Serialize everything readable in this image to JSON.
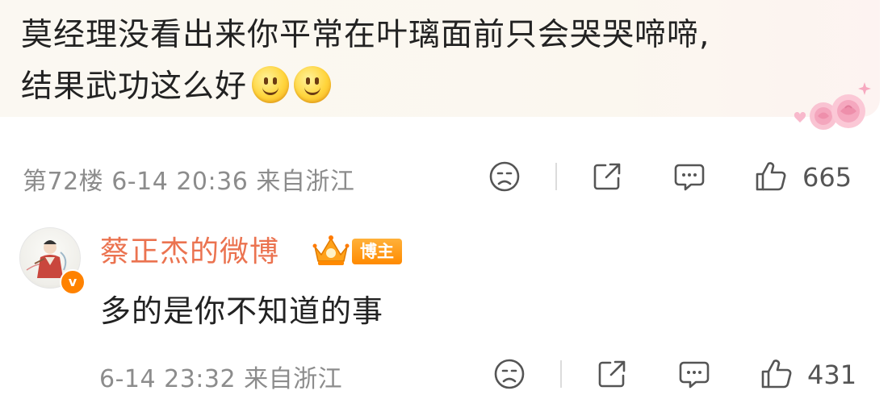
{
  "comment": {
    "text_line1": "莫经理没看出来你平常在叶璃面前只会哭哭啼啼,",
    "text_line2": "结果武功这么好",
    "emojis": [
      "smile-emoji",
      "smile-emoji"
    ],
    "meta": "第72楼 6-14 20:36 来自浙江",
    "like_count": "665"
  },
  "reply": {
    "username": "蔡正杰的微博",
    "badge": "博主",
    "text": "多的是你不知道的事",
    "meta": "6-14 23:32 来自浙江",
    "like_count": "431"
  },
  "colors": {
    "username": "#eb7350",
    "badge": "#ff8a00",
    "meta": "#8c8c8c",
    "verified": "#ff8200"
  }
}
